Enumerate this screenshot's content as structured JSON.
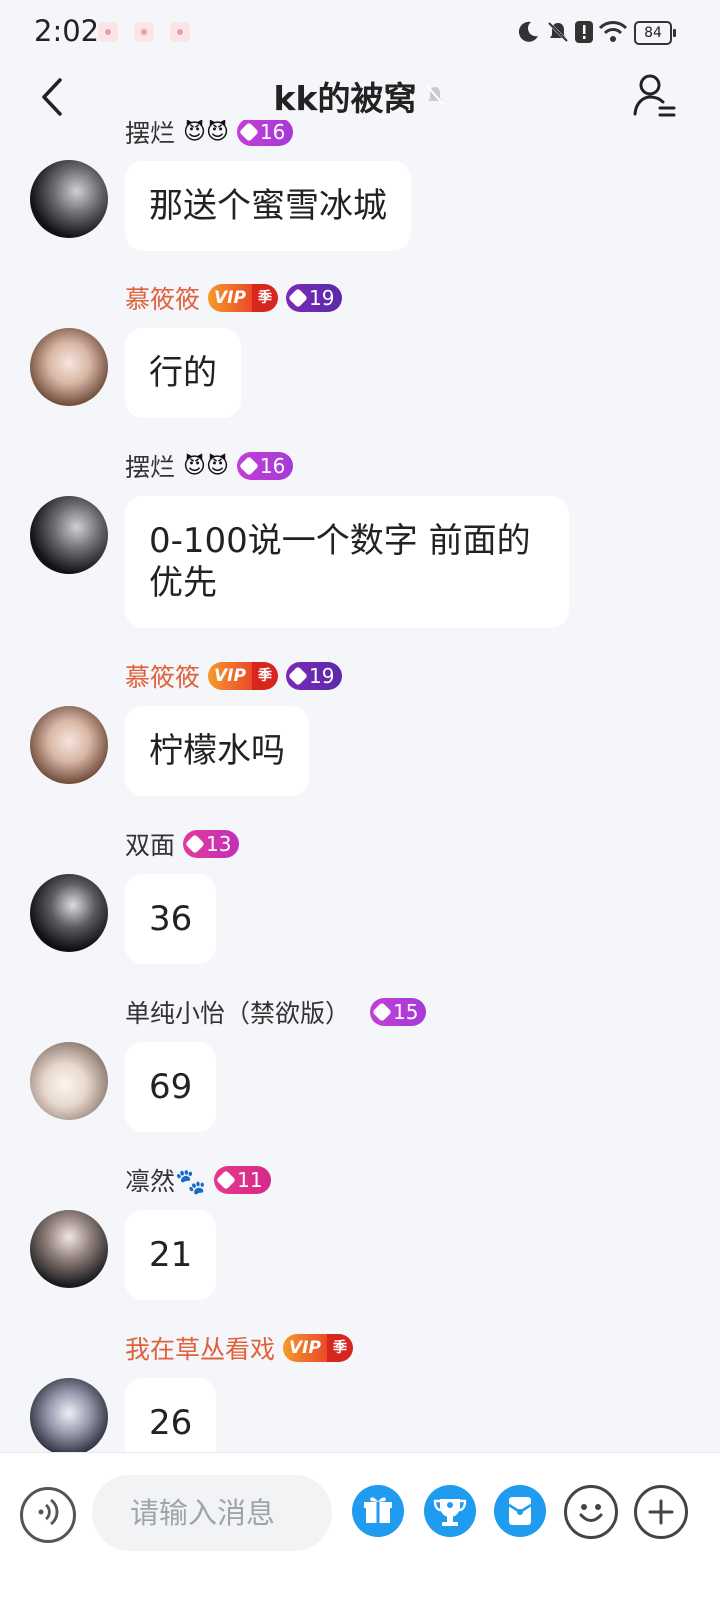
{
  "status_bar": {
    "time": "2:02",
    "battery": "84"
  },
  "header": {
    "title": "kk的被窝"
  },
  "messages": [
    {
      "name": "摆烂",
      "level": "16",
      "text": "那送个蜜雪冰城"
    },
    {
      "name": "慕筱筱",
      "vip": "VIP",
      "vip_suffix": "季",
      "level": "19",
      "text": "行的"
    },
    {
      "name": "摆烂",
      "level": "16",
      "text": "0-100说一个数字 前面的优先"
    },
    {
      "name": "慕筱筱",
      "vip": "VIP",
      "vip_suffix": "季",
      "level": "19",
      "text": "柠檬水吗"
    },
    {
      "name": "双面",
      "level": "13",
      "text": "36"
    },
    {
      "name": "单纯小怡（禁欲版）",
      "level": "15",
      "text": "69"
    },
    {
      "name": "凛然🐾",
      "level": "11",
      "text": "21"
    },
    {
      "name": "我在草丛看戏",
      "vip": "VIP",
      "vip_suffix": "季",
      "text": "26"
    }
  ],
  "input": {
    "placeholder": "请输入消息"
  },
  "toolbar": [
    "voice-icon",
    "gift-icon",
    "trophy-icon",
    "red-packet-icon",
    "emoji-icon",
    "plus-icon"
  ],
  "colors": {
    "accent": "#1f9bf0",
    "vip_name": "#e0623d",
    "bubble": "#ffffff",
    "background": "#f4f6f9"
  }
}
